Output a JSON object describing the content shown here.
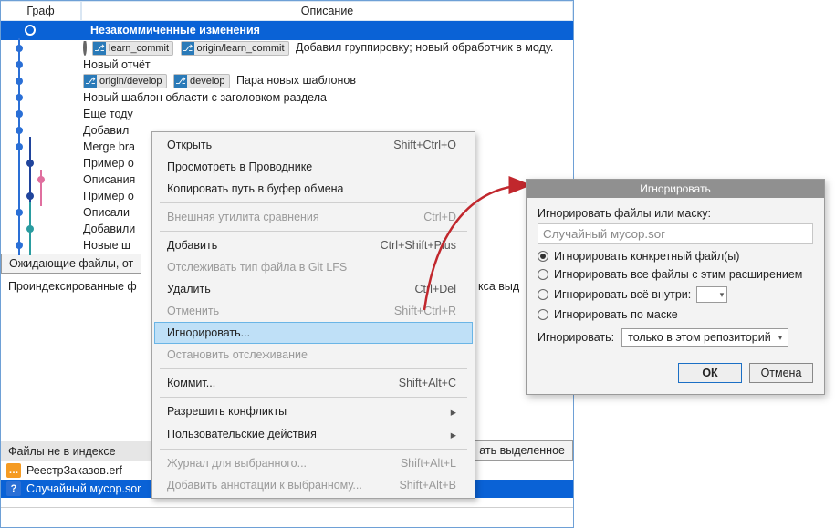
{
  "columns": {
    "graph": "Граф",
    "desc": "Описание"
  },
  "uncommitted": "Незакоммиченные изменения",
  "branches": {
    "learn_commit": "learn_commit",
    "origin_learn_commit": "origin/learn_commit",
    "origin_develop": "origin/develop",
    "develop": "develop"
  },
  "commits": {
    "0": "Добавил группировку; новый обработчик в моду.",
    "1": "Новый отчёт",
    "2": "Пара новых шаблонов",
    "3": "Новый шаблон области с заголовком раздела",
    "4": "Еще тоду",
    "5": "Добавил",
    "6": "Merge bra",
    "7": "Пример о",
    "8": "Описания",
    "9": "Пример о",
    "10": "Описали",
    "11": "Добавили",
    "12": "Новые ш"
  },
  "pending_files_label": "Ожидающие файлы, от",
  "indexed_label": "Проиндексированные ф",
  "unindexed_label": "Файлы не в индексе",
  "extra_suffix": "кса выд",
  "stage_selected_btn": "ать выделенное",
  "files": {
    "0": "РеестрЗаказов.erf",
    "1": "Случайный мусор.sor"
  },
  "menu": {
    "open": {
      "label": "Открыть",
      "key": "Shift+Ctrl+O"
    },
    "explore": {
      "label": "Просмотреть в Проводнике"
    },
    "copy_path": {
      "label": "Копировать путь в буфер обмена"
    },
    "ext_tool": {
      "label": "Внешняя утилита сравнения",
      "key": "Ctrl+D"
    },
    "add": {
      "label": "Добавить",
      "key": "Ctrl+Shift+Plus"
    },
    "track_lfs": {
      "label": "Отслеживать тип файла в Git LFS"
    },
    "remove": {
      "label": "Удалить",
      "key": "Ctrl+Del"
    },
    "discard": {
      "label": "Отменить",
      "key": "Shift+Ctrl+R"
    },
    "ignore": {
      "label": "Игнорировать..."
    },
    "stop_track": {
      "label": "Остановить отслеживание"
    },
    "commit": {
      "label": "Коммит...",
      "key": "Shift+Alt+C"
    },
    "resolve": {
      "label": "Разрешить конфликты"
    },
    "custom": {
      "label": "Пользовательские действия"
    },
    "log_sel": {
      "label": "Журнал для выбранного...",
      "key": "Shift+Alt+L"
    },
    "blame": {
      "label": "Добавить аннотации к выбранному...",
      "key": "Shift+Alt+B"
    }
  },
  "dialog": {
    "title": "Игнорировать",
    "mask_label": "Игнорировать файлы или маску:",
    "mask_value": "Случайный мусор.sor",
    "opt1": "Игнорировать конкретный файл(ы)",
    "opt2": "Игнорировать все файлы с этим расширением",
    "opt3": "Игнорировать всё внутри:",
    "opt4": "Игнорировать по маске",
    "scope_label": "Игнорировать:",
    "scope_value": "только в этом репозиторий",
    "ok": "ОК",
    "cancel": "Отмена"
  }
}
